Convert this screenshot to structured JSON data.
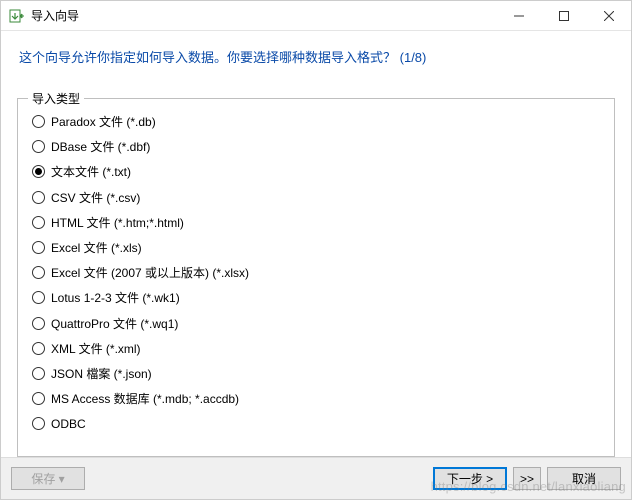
{
  "window": {
    "title": "导入向导"
  },
  "heading": {
    "text": "这个向导允许你指定如何导入数据。你要选择哪种数据导入格式？",
    "step": "(1/8)"
  },
  "group": {
    "legend": "导入类型",
    "options": [
      {
        "label": "Paradox 文件 (*.db)",
        "selected": false
      },
      {
        "label": "DBase 文件 (*.dbf)",
        "selected": false
      },
      {
        "label": "文本文件 (*.txt)",
        "selected": true
      },
      {
        "label": "CSV 文件 (*.csv)",
        "selected": false
      },
      {
        "label": "HTML 文件 (*.htm;*.html)",
        "selected": false
      },
      {
        "label": "Excel 文件 (*.xls)",
        "selected": false
      },
      {
        "label": "Excel 文件 (2007 或以上版本) (*.xlsx)",
        "selected": false
      },
      {
        "label": "Lotus 1-2-3 文件 (*.wk1)",
        "selected": false
      },
      {
        "label": "QuattroPro 文件 (*.wq1)",
        "selected": false
      },
      {
        "label": "XML 文件 (*.xml)",
        "selected": false
      },
      {
        "label": "JSON 檔案 (*.json)",
        "selected": false
      },
      {
        "label": "MS Access 数据库 (*.mdb; *.accdb)",
        "selected": false
      },
      {
        "label": "ODBC",
        "selected": false
      }
    ]
  },
  "footer": {
    "save": "保存",
    "next": "下一步 >",
    "skip": ">>",
    "cancel": "取消"
  },
  "watermark": "https://blog.csdn.net/lanxiaoliang"
}
